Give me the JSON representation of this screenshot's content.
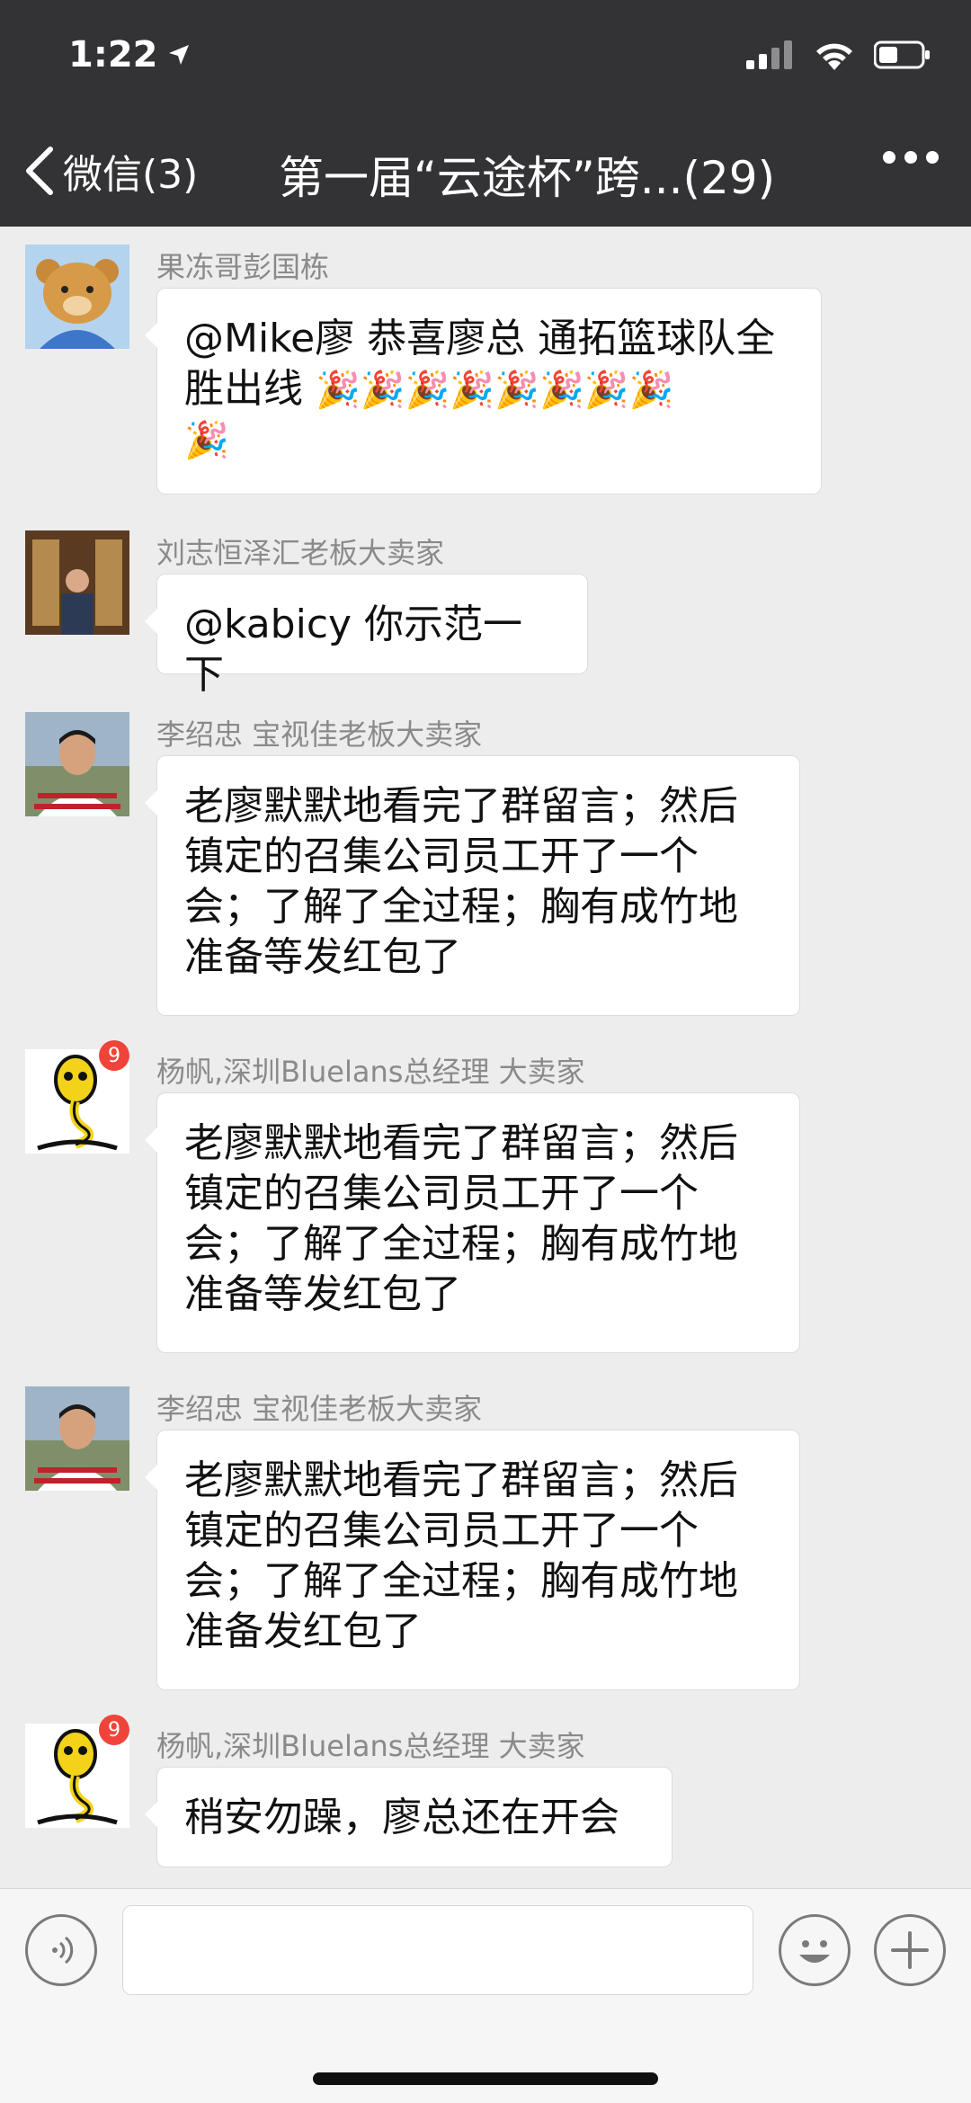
{
  "status_bar": {
    "time": "1:22"
  },
  "nav": {
    "back_label": "微信(3)",
    "title": "第一届“云途杯”跨...(29)"
  },
  "messages": [
    {
      "sender": "果冻哥彭国栋",
      "text_line1": "@Mike廖 恭喜廖总 通拓篮球队全",
      "text_line2": "胜出线",
      "party_icons": "🎉🎉🎉🎉🎉🎉🎉🎉",
      "party_icons_line3": "🎉"
    },
    {
      "sender": "刘志恒泽汇老板大卖家",
      "text": "@kabicy 你示范一下"
    },
    {
      "sender": "李绍忠 宝视佳老板大卖家",
      "lines": [
        "老廖默默地看完了群留言；然后",
        "镇定的召集公司员工开了一个",
        "会；了解了全过程；胸有成竹地",
        "准备等发红包了"
      ]
    },
    {
      "sender": "杨帆,深圳Bluelans总经理 大卖家",
      "badge": "9",
      "lines": [
        "老廖默默地看完了群留言；然后",
        "镇定的召集公司员工开了一个",
        "会；了解了全过程；胸有成竹地",
        "准备等发红包了"
      ]
    },
    {
      "sender": "李绍忠 宝视佳老板大卖家",
      "lines": [
        "老廖默默地看完了群留言；然后",
        "镇定的召集公司员工开了一个",
        "会；了解了全过程；胸有成竹地",
        "准备发红包了"
      ]
    },
    {
      "sender": "杨帆,深圳Bluelans总经理 大卖家",
      "badge": "9",
      "text": "稍安勿躁，廖总还在开会"
    }
  ],
  "input_bar": {
    "text_value": ""
  },
  "colors": {
    "header_bg": "#333336",
    "chat_bg": "#ededed",
    "badge": "#f0443a"
  }
}
